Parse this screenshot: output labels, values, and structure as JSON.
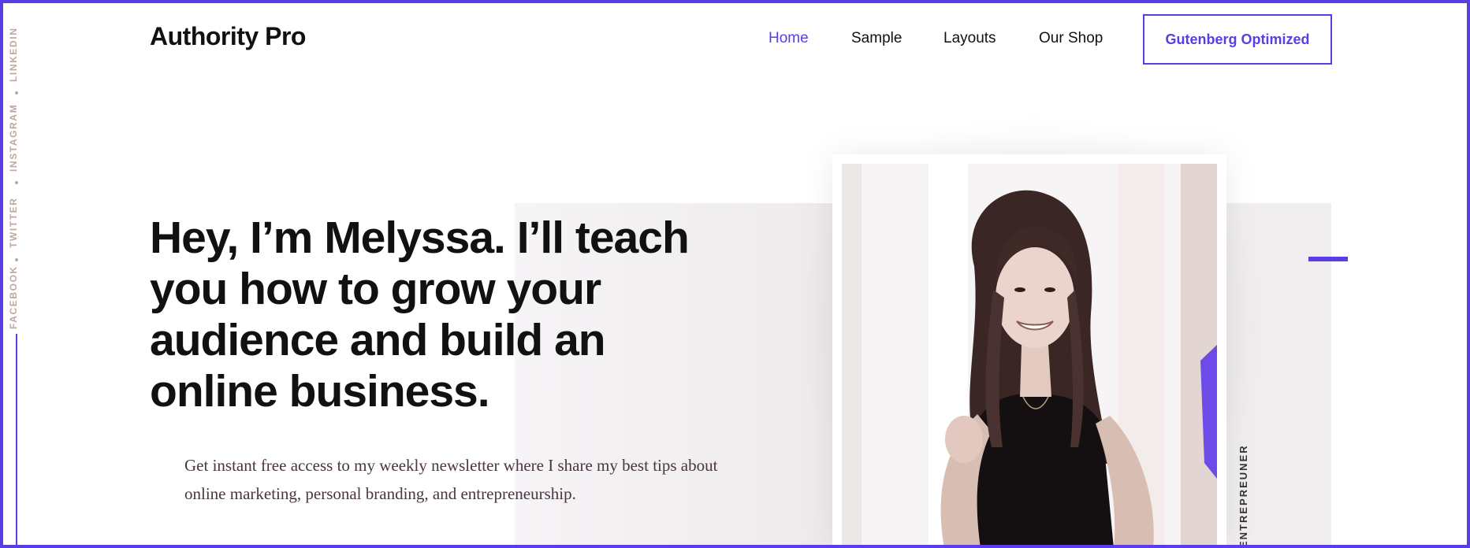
{
  "social": {
    "links": [
      {
        "label": "LINKEDIN"
      },
      {
        "label": "INSTAGRAM"
      },
      {
        "label": "TWITTER"
      },
      {
        "label": "FACEBOOK"
      }
    ]
  },
  "header": {
    "logo": "Authority Pro",
    "nav": [
      {
        "label": "Home",
        "active": true
      },
      {
        "label": "Sample",
        "active": false
      },
      {
        "label": "Layouts",
        "active": false
      },
      {
        "label": "Our Shop",
        "active": false
      }
    ],
    "cta_label": "Gutenberg Optimized"
  },
  "hero": {
    "headline": "Hey, I’m Melyssa. I’ll teach you how to grow your audience and build an online business.",
    "intro": "Get instant free access to my weekly newsletter where I share my best tips about online marketing, personal branding, and entrepreneurship.",
    "vertical_tag": "ENTREPREUNER"
  },
  "colors": {
    "accent": "#5b3de6",
    "text": "#111111",
    "social_text": "#c2a6a0",
    "body_text": "#4a3540"
  },
  "icons": [
    "portrait-photo"
  ]
}
